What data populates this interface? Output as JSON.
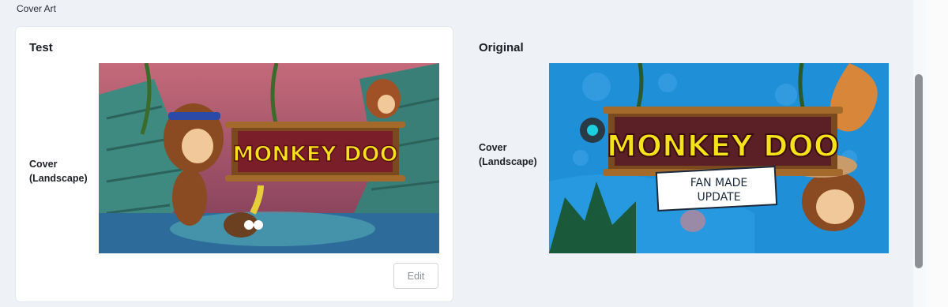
{
  "section": {
    "label": "Cover Art"
  },
  "test_card": {
    "title": "Test",
    "field_label_line1": "Cover",
    "field_label_line2": "(Landscape)",
    "edit_label": "Edit",
    "art": {
      "title_text": "MONKEY DOO",
      "palette": {
        "sky": "#b7566a",
        "stone": "#3f8a80",
        "water": "#2d6b9a",
        "sign_bg": "#7a1e2a",
        "title_fill": "#f5e21a"
      }
    }
  },
  "orig_card": {
    "title": "Original",
    "field_label_line1": "Cover",
    "field_label_line2": "(Landscape)",
    "art": {
      "title_text": "MONKEY DOO",
      "subtitle_line1": "FAN MADE",
      "subtitle_line2": "UPDATE",
      "palette": {
        "sky": "#1f8fd8",
        "sign_bg": "#5b1f26",
        "title_fill": "#f5e21a"
      }
    }
  },
  "scrollbar": {
    "color": "#8d9196"
  }
}
